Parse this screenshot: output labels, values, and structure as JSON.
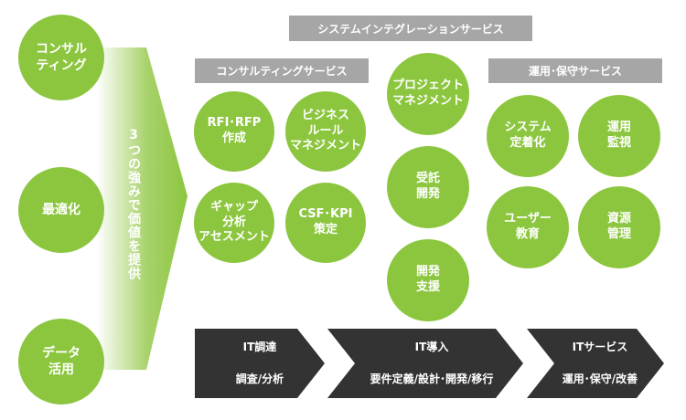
{
  "strengths": [
    "コンサル\nティング",
    "最適化",
    "データ\n活用"
  ],
  "arrow_text": "3つの強みで価値を提供",
  "top_bar": "システムインテグレーションサービス",
  "consulting": {
    "header": "コンサルティングサービス",
    "items": [
      "RFI･RFP\n作成",
      "ビジネス\nルール\nマネジメント",
      "ギャップ\n分析\nアセスメント",
      "CSF･KPI\n策定"
    ]
  },
  "middle": {
    "items": [
      "プロジェクト\nマネジメント",
      "受託\n開発",
      "開発\n支援"
    ]
  },
  "operations": {
    "header": "運用･保守サービス",
    "items": [
      "システム\n定着化",
      "運用\n監視",
      "ユーザー\n教育",
      "資源\n管理"
    ]
  },
  "phases": [
    {
      "line1": "IT調達",
      "line2": "調査/分析"
    },
    {
      "line1": "IT導入",
      "line2": "要件定義/設計･開発/移行"
    },
    {
      "line1": "ITサービス",
      "line2": "運用･保守/改善"
    }
  ],
  "colors": {
    "green": "#8cc63f",
    "light_green": "#c9e3a4",
    "gray": "#a6a6a6",
    "dark": "#333333"
  }
}
